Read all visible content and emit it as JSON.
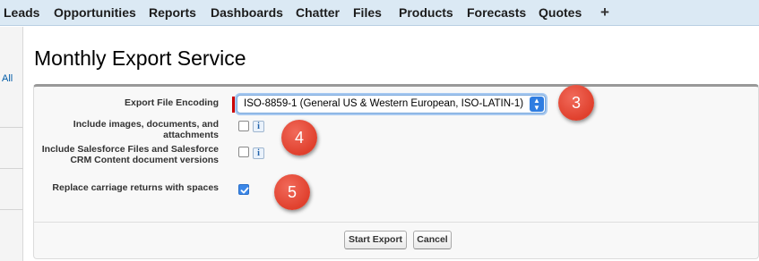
{
  "nav": {
    "tabs": [
      "Leads",
      "Opportunities",
      "Reports",
      "Dashboards",
      "Chatter",
      "Files",
      "Products",
      "Forecasts",
      "Quotes"
    ],
    "plus": "+"
  },
  "sidebar": {
    "all_label": "All"
  },
  "page": {
    "title": "Monthly Export Service"
  },
  "form": {
    "encoding": {
      "label": "Export File Encoding",
      "value": "ISO-8859-1 (General US & Western European, ISO-LATIN-1)"
    },
    "include_images": {
      "label": "Include images, documents, and attachments",
      "checked": false
    },
    "include_files": {
      "label": "Include Salesforce Files and Salesforce CRM Content document versions",
      "checked": false
    },
    "replace_returns": {
      "label": "Replace carriage returns with spaces",
      "checked": true
    },
    "info_glyph": "i"
  },
  "buttons": {
    "start": "Start Export",
    "cancel": "Cancel"
  },
  "badges": {
    "b3": "3",
    "b4": "4",
    "b5": "5"
  },
  "colors": {
    "nav_bg": "#dbe9f4",
    "badge": "#e0402d",
    "select_accent": "#2f7de1",
    "required_bar": "#cc0000"
  }
}
